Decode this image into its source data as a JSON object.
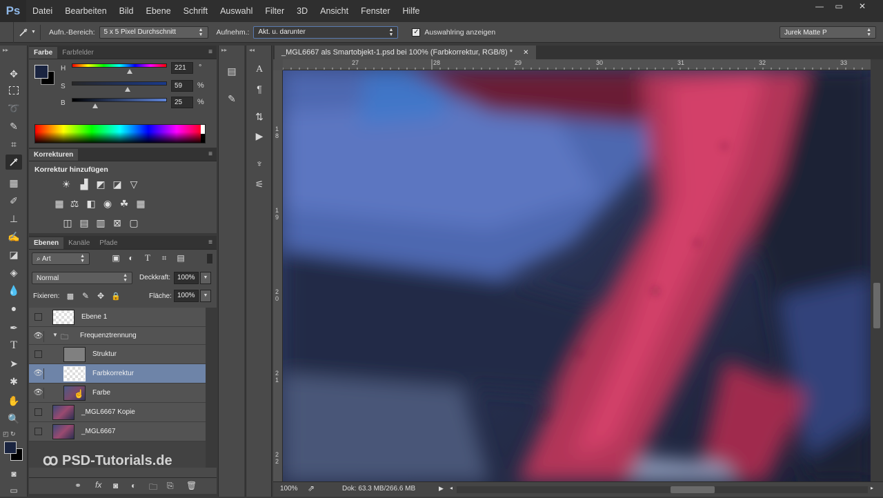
{
  "app": {
    "logo": "Ps"
  },
  "menu": [
    "Datei",
    "Bearbeiten",
    "Bild",
    "Ebene",
    "Schrift",
    "Auswahl",
    "Filter",
    "3D",
    "Ansicht",
    "Fenster",
    "Hilfe"
  ],
  "window_controls": {
    "minimize": "—",
    "restore": "▭",
    "close": "✕"
  },
  "options": {
    "sample_size_label": "Aufn.-Bereich:",
    "sample_size_value": "5 x 5 Pixel Durchschnitt",
    "sample_label": "Aufnehm.:",
    "sample_value": "Akt. u. darunter",
    "show_ring_label": "Auswahlring anzeigen",
    "show_ring_checked": true,
    "workspace": "Jurek Matte P"
  },
  "color_panel": {
    "tabs": [
      "Farbe",
      "Farbfelder"
    ],
    "h_label": "H",
    "h_value": "221",
    "h_unit": "°",
    "s_label": "S",
    "s_value": "59",
    "s_unit": "%",
    "b_label": "B",
    "b_value": "25",
    "b_unit": "%",
    "foreground": "#1a2440",
    "background": "#000000"
  },
  "adjustments_panel": {
    "tab": "Korrekturen",
    "heading": "Korrektur hinzufügen"
  },
  "layers_panel": {
    "tabs": [
      "Ebenen",
      "Kanäle",
      "Pfade"
    ],
    "filter_label": "Art",
    "blend_mode": "Normal",
    "opacity_label": "Deckkraft:",
    "opacity_value": "100%",
    "lock_label": "Fixieren:",
    "fill_label": "Fläche:",
    "fill_value": "100%",
    "layers": [
      {
        "name": "Ebene 1",
        "visible": false
      },
      {
        "name": "Frequenztrennung",
        "visible": true
      },
      {
        "name": "Struktur",
        "visible": false
      },
      {
        "name": "Farbkorrektur",
        "visible": true
      },
      {
        "name": "Farbe",
        "visible": true
      },
      {
        "name": "_MGL6667 Kopie",
        "visible": false
      },
      {
        "name": "_MGL6667",
        "visible": false
      }
    ]
  },
  "document": {
    "tab_title": "_MGL6667 als Smartobjekt-1.psd bei 100% (Farbkorrektur, RGB/8) *",
    "ruler_top": [
      "27",
      "28",
      "29",
      "30",
      "31",
      "32",
      "33"
    ],
    "ruler_left": [
      "1 8",
      "1 9",
      "2 0",
      "2 1",
      "2 2"
    ]
  },
  "status": {
    "zoom": "100%",
    "doc_info": "Dok: 63.3 MB/266.6 MB"
  },
  "watermark": "PSD-Tutorials.de"
}
